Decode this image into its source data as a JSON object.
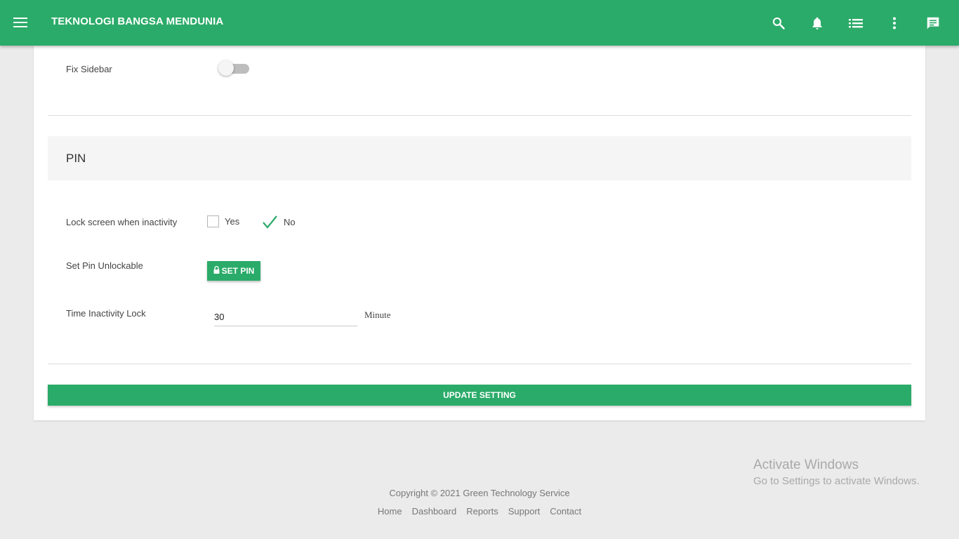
{
  "colors": {
    "primary": "#2bab69",
    "background": "#ebebeb"
  },
  "header": {
    "title": "TEKNOLOGI BANGSA MENDUNIA",
    "icons": [
      "menu-icon",
      "search-icon",
      "bell-icon",
      "list-icon",
      "more-vert-icon",
      "chat-icon"
    ]
  },
  "layout_section": {
    "fix_sidebar_label": "Fix Sidebar",
    "fix_sidebar_on": false
  },
  "pin": {
    "heading": "PIN",
    "lock_label": "Lock screen when inactivity",
    "yes_label": "Yes",
    "no_label": "No",
    "selected": "No",
    "set_pin_label": "Set Pin Unlockable",
    "set_pin_button": "SET PIN",
    "time_label": "Time Inactivity Lock",
    "time_value": "30",
    "time_unit": "Minute"
  },
  "update_button": "UPDATE SETTING",
  "footer": {
    "copyright": "Copyright © 2021 Green Technology Service",
    "links": [
      "Home",
      "Dashboard",
      "Reports",
      "Support",
      "Contact"
    ]
  },
  "watermark": {
    "line1": "Activate Windows",
    "line2": "Go to Settings to activate Windows."
  }
}
